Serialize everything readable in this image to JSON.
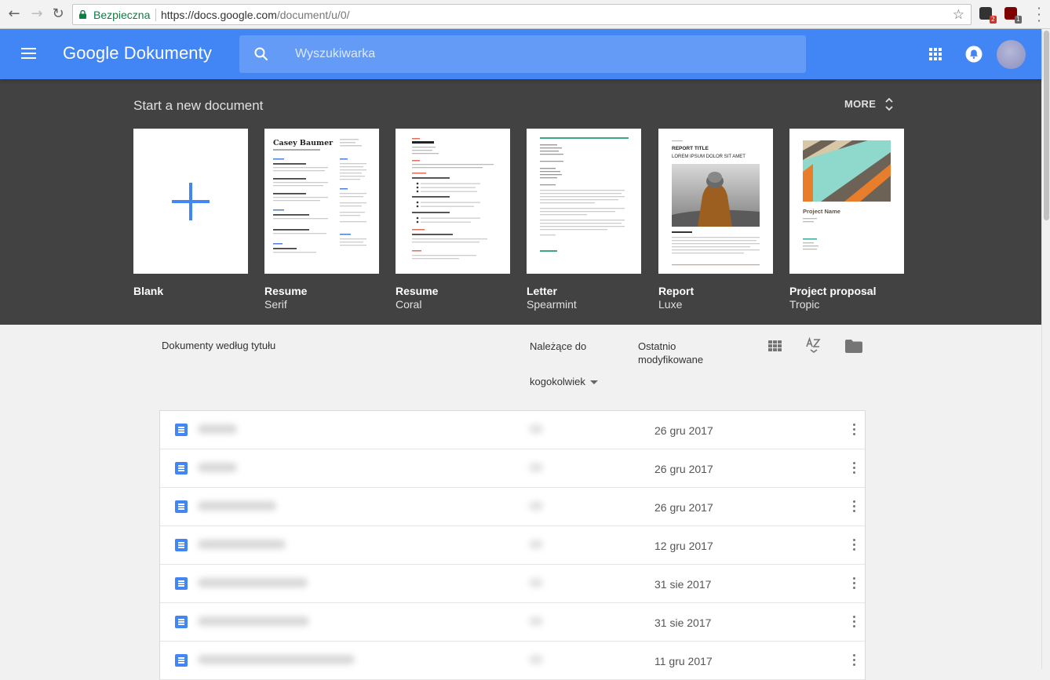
{
  "browser": {
    "secure_label": "Bezpieczna",
    "url_host": "https://docs.google.com",
    "url_path": "/document/u/0/",
    "ext1_badge": "2",
    "ext2_badge": "1"
  },
  "header": {
    "product_name": "Google Dokumenty",
    "search_placeholder": "Wyszukiwarka",
    "accent_color": "#4285f4"
  },
  "gallery": {
    "title": "Start a new document",
    "more_label": "MORE",
    "templates": [
      {
        "name": "Blank",
        "sub": ""
      },
      {
        "name": "Resume",
        "sub": "Serif",
        "thumb_heading": "Casey Baumer"
      },
      {
        "name": "Resume",
        "sub": "Coral"
      },
      {
        "name": "Letter",
        "sub": "Spearmint"
      },
      {
        "name": "Report",
        "sub": "Luxe",
        "thumb_heading": "REPORT TITLE",
        "thumb_sub": "LOREM IPSUM DOLOR SIT AMET"
      },
      {
        "name": "Project proposal",
        "sub": "Tropic",
        "thumb_heading": "Project Name"
      }
    ]
  },
  "list_header": {
    "title_col": "Dokumenty według tytułu",
    "owner_col": "Należące do",
    "owner_value": "kogokolwiek",
    "modified_col_line1": "Ostatnio",
    "modified_col_line2": "modyfikowane"
  },
  "documents": [
    {
      "date": "26 gru 2017"
    },
    {
      "date": "26 gru 2017"
    },
    {
      "date": "26 gru 2017"
    },
    {
      "date": "12 gru 2017"
    },
    {
      "date": "31 sie 2017"
    },
    {
      "date": "31 sie 2017"
    },
    {
      "date": "11 gru 2017"
    }
  ]
}
